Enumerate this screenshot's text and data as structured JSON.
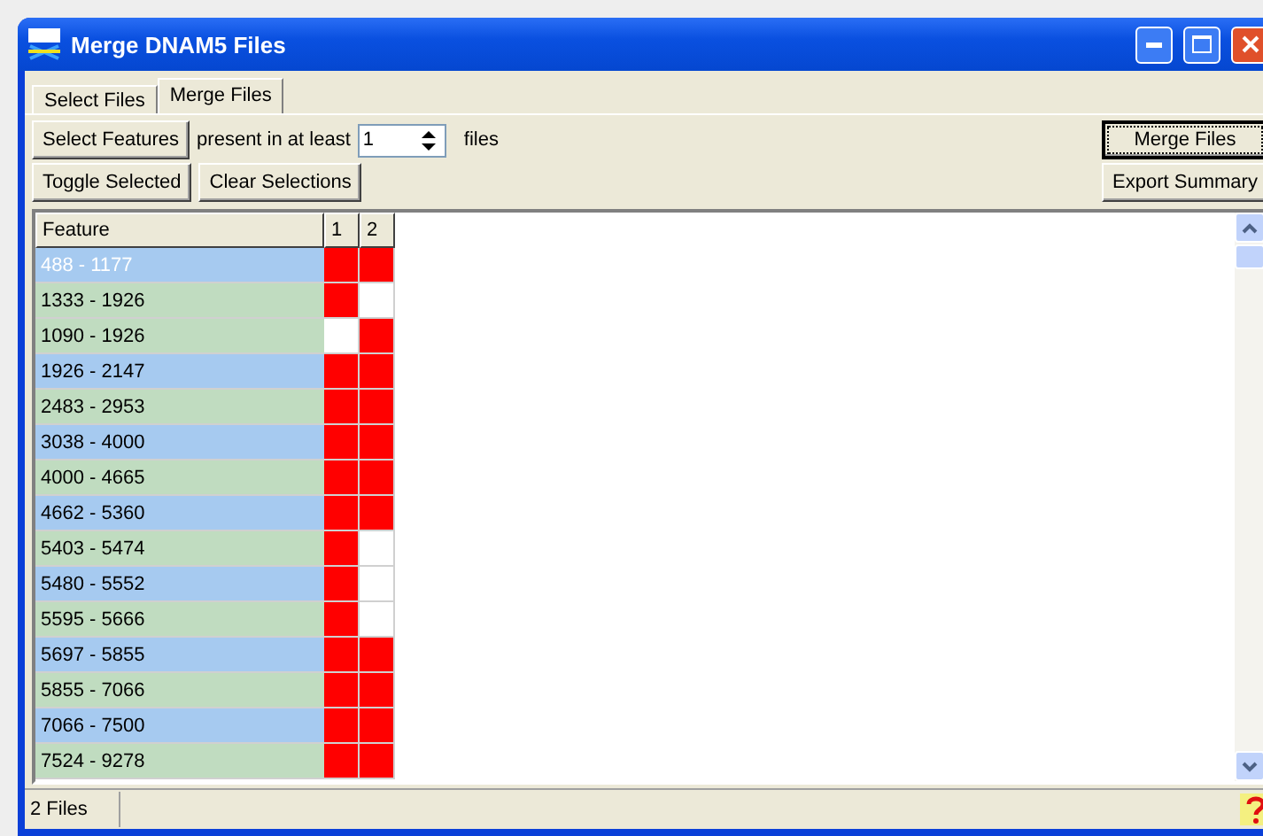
{
  "window": {
    "title": "Merge DNAM5 Files"
  },
  "tabs": [
    {
      "label": "Select Files",
      "selected": false
    },
    {
      "label": "Merge Files",
      "selected": true
    }
  ],
  "toolbar": {
    "select_button": "Select Features",
    "present_label": "present in at least",
    "present_value": "1",
    "files_label": "files",
    "toggle_button": "Toggle Selected",
    "clear_button": "Clear Selections",
    "merge_button": "Merge Files",
    "export_button": "Export Summary"
  },
  "table": {
    "columns": [
      "Feature",
      "1",
      "2"
    ],
    "rows": [
      {
        "feature": "488 - 1177",
        "color": "#a6caf0",
        "selected": true,
        "cells": [
          true,
          true
        ]
      },
      {
        "feature": "1333 - 1926",
        "color": "#c0dcc0",
        "selected": false,
        "cells": [
          true,
          false
        ]
      },
      {
        "feature": "1090 - 1926",
        "color": "#c0dcc0",
        "selected": false,
        "cells": [
          false,
          true
        ]
      },
      {
        "feature": "1926 - 2147",
        "color": "#a6caf0",
        "selected": false,
        "cells": [
          true,
          true
        ]
      },
      {
        "feature": "2483 - 2953",
        "color": "#c0dcc0",
        "selected": false,
        "cells": [
          true,
          true
        ]
      },
      {
        "feature": "3038 - 4000",
        "color": "#a6caf0",
        "selected": false,
        "cells": [
          true,
          true
        ]
      },
      {
        "feature": "4000 - 4665",
        "color": "#c0dcc0",
        "selected": false,
        "cells": [
          true,
          true
        ]
      },
      {
        "feature": "4662 - 5360",
        "color": "#a6caf0",
        "selected": false,
        "cells": [
          true,
          true
        ]
      },
      {
        "feature": "5403 - 5474",
        "color": "#c0dcc0",
        "selected": false,
        "cells": [
          true,
          false
        ]
      },
      {
        "feature": "5480 - 5552",
        "color": "#a6caf0",
        "selected": false,
        "cells": [
          true,
          false
        ]
      },
      {
        "feature": "5595 - 5666",
        "color": "#c0dcc0",
        "selected": false,
        "cells": [
          true,
          false
        ]
      },
      {
        "feature": "5697 - 5855",
        "color": "#a6caf0",
        "selected": false,
        "cells": [
          true,
          true
        ]
      },
      {
        "feature": "5855 - 7066",
        "color": "#c0dcc0",
        "selected": false,
        "cells": [
          true,
          true
        ]
      },
      {
        "feature": "7066 - 7500",
        "color": "#a6caf0",
        "selected": false,
        "cells": [
          true,
          true
        ]
      },
      {
        "feature": "7524 - 9278",
        "color": "#c0dcc0",
        "selected": false,
        "cells": [
          true,
          true
        ]
      }
    ]
  },
  "status_bar": {
    "text": "2 Files"
  }
}
